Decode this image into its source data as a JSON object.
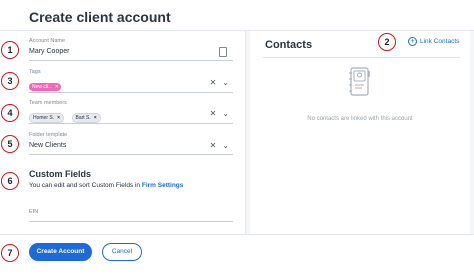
{
  "header": {
    "title": "Create client account"
  },
  "form": {
    "account_name": {
      "label": "Account Name",
      "value": "Mary Cooper"
    },
    "tags": {
      "label": "Tags",
      "chips": [
        "New cli..."
      ]
    },
    "team_members": {
      "label": "Team members",
      "chips": [
        "Homer S.",
        "Bart S."
      ]
    },
    "folder_template": {
      "label": "Folder template",
      "value": "New Clients"
    },
    "custom_fields": {
      "title": "Custom Fields",
      "text": "You can edit and sort Custom Fields in",
      "link": "Firm Settings"
    },
    "ein": {
      "label": "EIN"
    }
  },
  "contacts": {
    "title": "Contacts",
    "link_label": "Link Contacts",
    "empty_text": "No contacts are linked with this account"
  },
  "footer": {
    "create_label": "Create Account",
    "cancel_label": "Cancel"
  },
  "markers": [
    "1",
    "2",
    "3",
    "4",
    "5",
    "6",
    "7"
  ],
  "colors": {
    "accent": "#1e6ad6",
    "tag": "#f168b9",
    "marker": "#d0161a"
  }
}
